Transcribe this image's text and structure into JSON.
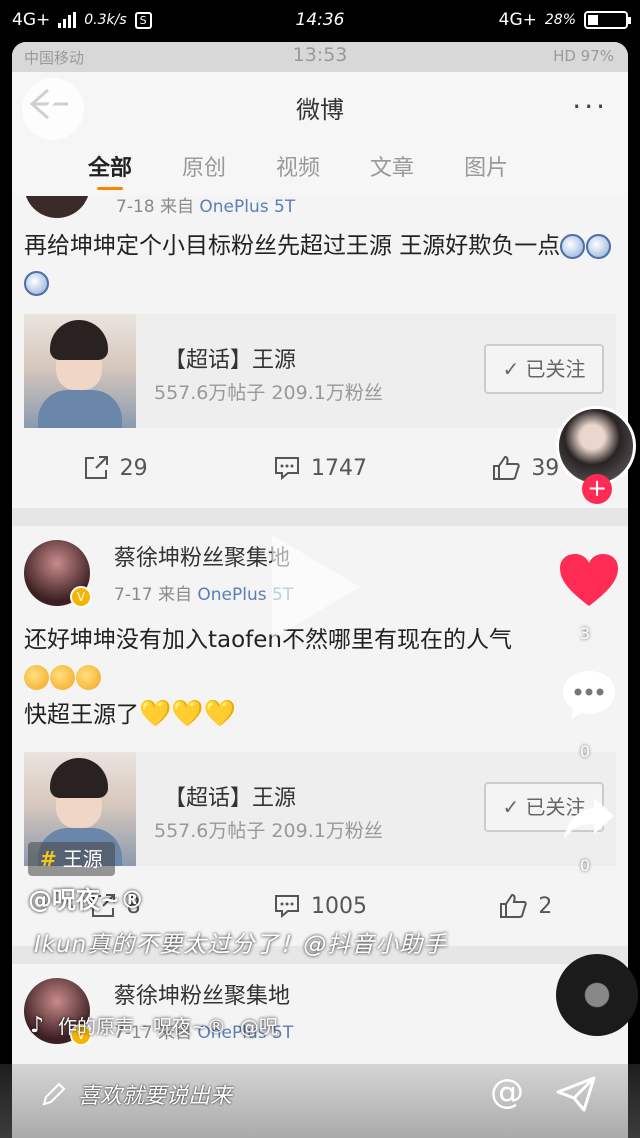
{
  "outer_status": {
    "network": "4G+",
    "speed": "0.3k/s",
    "s_icon": "S",
    "time": "14:36",
    "network_right": "4G+",
    "battery": "28%"
  },
  "inner_status": {
    "carrier": "中国移动",
    "time": "13:53",
    "right": "HD 97%"
  },
  "weibo": {
    "title": "微博",
    "more": "···",
    "tabs": [
      "全部",
      "原创",
      "视频",
      "文章",
      "图片"
    ],
    "post1": {
      "date": "7-18",
      "from": "来自",
      "source": "OnePlus 5T",
      "text": "再给坤坤定个小目标粉丝先超过王源  王源好欺负一点",
      "card": {
        "title": "【超话】王源",
        "stats": "557.6万帖子 209.1万粉丝",
        "button": "✓ 已关注"
      },
      "reposts": "29",
      "comments": "1747",
      "likes": "39"
    },
    "post2": {
      "username": "蔡徐坤粉丝聚集地",
      "date": "7-17",
      "from": "来自",
      "source": "OnePlus 5T",
      "text_line1": "还好坤坤没有加入taofen不然哪里有现在的人气",
      "text_line2_prefix": "快超王源了",
      "hearts": "💛💛💛",
      "card": {
        "title": "【超话】王源",
        "stats": "557.6万帖子 209.1万粉丝",
        "button": "✓ 已关注"
      },
      "reposts": "8",
      "comments": "1005",
      "likes": "2"
    },
    "post3": {
      "username": "蔡徐坤粉丝聚集地",
      "date": "7-17",
      "from": "来自",
      "source": "OnePlus 5T"
    }
  },
  "video_overlay": {
    "like_count": "3",
    "comment_count": "0",
    "share_count": "0",
    "hashtag": "王源",
    "author": "@呪夜~®",
    "caption": "Ikun真的不要太过分了！@抖音小助手",
    "music": "作的原声 - 呪夜~®",
    "music_author": "@呪",
    "comment_placeholder": "喜欢就要说出来",
    "at_symbol": "@"
  },
  "colors": {
    "weibo_orange": "#ff8200",
    "douyin_red": "#fe2c55",
    "link_blue": "#5b7fb4",
    "heart_gold": "#e6a817"
  },
  "icons": [
    "back-arrow-icon",
    "more-icon",
    "share-icon",
    "comment-icon",
    "like-icon",
    "play-icon",
    "heart-icon",
    "music-note-icon",
    "send-icon",
    "pencil-icon"
  ]
}
